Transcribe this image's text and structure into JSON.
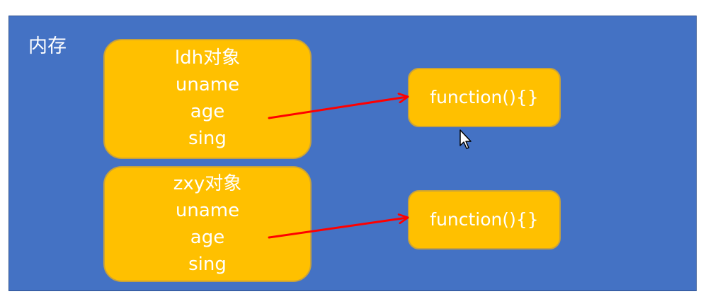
{
  "diagram": {
    "memory_label": "内存",
    "objects": [
      {
        "title": "ldh对象",
        "props": [
          "uname",
          "age",
          "sing"
        ]
      },
      {
        "title": "zxy对象",
        "props": [
          "uname",
          "age",
          "sing"
        ]
      }
    ],
    "functions": [
      {
        "label": "function(){}"
      },
      {
        "label": "function(){}"
      }
    ],
    "colors": {
      "region": "#4472c4",
      "box_fill": "#ffc000",
      "box_border": "#c9a23a",
      "arrow": "#ff0000",
      "text": "#ffffff"
    }
  },
  "overlay": {
    "cursor_icon": "mouse-pointer-icon"
  }
}
